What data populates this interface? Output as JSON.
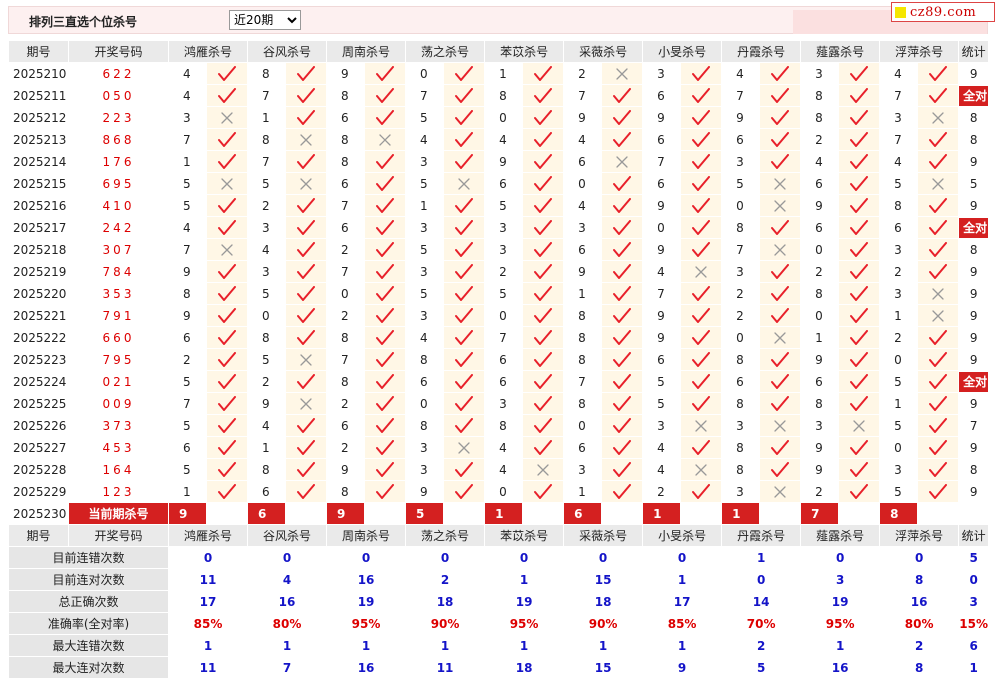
{
  "header": {
    "title": "排列三直选个位杀号",
    "range_select": "近20期",
    "logo_text": "cz89.com"
  },
  "columns": [
    "期号",
    "开奖号码",
    "鸿雁杀号",
    "谷风杀号",
    "周南杀号",
    "荡之杀号",
    "苯苡杀号",
    "采薇杀号",
    "小旻杀号",
    "丹霞杀号",
    "薤露杀号",
    "浮萍杀号",
    "统计"
  ],
  "all_correct_label": "全对",
  "rows": [
    {
      "period": "2025210",
      "draw": "622",
      "kills": [
        4,
        8,
        9,
        0,
        1,
        2,
        3,
        4,
        3,
        4
      ],
      "ok": [
        1,
        1,
        1,
        1,
        1,
        0,
        1,
        1,
        1,
        1
      ],
      "stat": "9"
    },
    {
      "period": "2025211",
      "draw": "050",
      "kills": [
        4,
        7,
        8,
        7,
        8,
        7,
        6,
        7,
        8,
        7
      ],
      "ok": [
        1,
        1,
        1,
        1,
        1,
        1,
        1,
        1,
        1,
        1
      ],
      "stat": "全对"
    },
    {
      "period": "2025212",
      "draw": "223",
      "kills": [
        3,
        1,
        6,
        5,
        0,
        9,
        9,
        9,
        8,
        3
      ],
      "ok": [
        0,
        1,
        1,
        1,
        1,
        1,
        1,
        1,
        1,
        0
      ],
      "stat": "8"
    },
    {
      "period": "2025213",
      "draw": "868",
      "kills": [
        7,
        8,
        8,
        4,
        4,
        4,
        6,
        6,
        2,
        7
      ],
      "ok": [
        1,
        0,
        0,
        1,
        1,
        1,
        1,
        1,
        1,
        1
      ],
      "stat": "8"
    },
    {
      "period": "2025214",
      "draw": "176",
      "kills": [
        1,
        7,
        8,
        3,
        9,
        6,
        7,
        3,
        4,
        4
      ],
      "ok": [
        1,
        1,
        1,
        1,
        1,
        0,
        1,
        1,
        1,
        1
      ],
      "stat": "9"
    },
    {
      "period": "2025215",
      "draw": "695",
      "kills": [
        5,
        5,
        6,
        5,
        6,
        0,
        6,
        5,
        6,
        5
      ],
      "ok": [
        0,
        0,
        1,
        0,
        1,
        1,
        1,
        0,
        1,
        0
      ],
      "stat": "5"
    },
    {
      "period": "2025216",
      "draw": "410",
      "kills": [
        5,
        2,
        7,
        1,
        5,
        4,
        9,
        0,
        9,
        8
      ],
      "ok": [
        1,
        1,
        1,
        1,
        1,
        1,
        1,
        0,
        1,
        1
      ],
      "stat": "9"
    },
    {
      "period": "2025217",
      "draw": "242",
      "kills": [
        4,
        3,
        6,
        3,
        3,
        3,
        0,
        8,
        6,
        6
      ],
      "ok": [
        1,
        1,
        1,
        1,
        1,
        1,
        1,
        1,
        1,
        1
      ],
      "stat": "全对"
    },
    {
      "period": "2025218",
      "draw": "307",
      "kills": [
        7,
        4,
        2,
        5,
        3,
        6,
        9,
        7,
        0,
        3
      ],
      "ok": [
        0,
        1,
        1,
        1,
        1,
        1,
        1,
        0,
        1,
        1
      ],
      "stat": "8"
    },
    {
      "period": "2025219",
      "draw": "784",
      "kills": [
        9,
        3,
        7,
        3,
        2,
        9,
        4,
        3,
        2,
        2
      ],
      "ok": [
        1,
        1,
        1,
        1,
        1,
        1,
        0,
        1,
        1,
        1
      ],
      "stat": "9"
    },
    {
      "period": "2025220",
      "draw": "353",
      "kills": [
        8,
        5,
        0,
        5,
        5,
        1,
        7,
        2,
        8,
        3
      ],
      "ok": [
        1,
        1,
        1,
        1,
        1,
        1,
        1,
        1,
        1,
        0
      ],
      "stat": "9"
    },
    {
      "period": "2025221",
      "draw": "791",
      "kills": [
        9,
        0,
        2,
        3,
        0,
        8,
        9,
        2,
        0,
        1
      ],
      "ok": [
        1,
        1,
        1,
        1,
        1,
        1,
        1,
        1,
        1,
        0
      ],
      "stat": "9"
    },
    {
      "period": "2025222",
      "draw": "660",
      "kills": [
        6,
        8,
        8,
        4,
        7,
        8,
        9,
        0,
        1,
        2
      ],
      "ok": [
        1,
        1,
        1,
        1,
        1,
        1,
        1,
        0,
        1,
        1
      ],
      "stat": "9"
    },
    {
      "period": "2025223",
      "draw": "795",
      "kills": [
        2,
        5,
        7,
        8,
        6,
        8,
        6,
        8,
        9,
        0
      ],
      "ok": [
        1,
        0,
        1,
        1,
        1,
        1,
        1,
        1,
        1,
        1
      ],
      "stat": "9"
    },
    {
      "period": "2025224",
      "draw": "021",
      "kills": [
        5,
        2,
        8,
        6,
        6,
        7,
        5,
        6,
        6,
        5
      ],
      "ok": [
        1,
        1,
        1,
        1,
        1,
        1,
        1,
        1,
        1,
        1
      ],
      "stat": "全对"
    },
    {
      "period": "2025225",
      "draw": "009",
      "kills": [
        7,
        9,
        2,
        0,
        3,
        8,
        5,
        8,
        8,
        1
      ],
      "ok": [
        1,
        0,
        1,
        1,
        1,
        1,
        1,
        1,
        1,
        1
      ],
      "stat": "9"
    },
    {
      "period": "2025226",
      "draw": "373",
      "kills": [
        5,
        4,
        6,
        8,
        8,
        0,
        3,
        3,
        3,
        5
      ],
      "ok": [
        1,
        1,
        1,
        1,
        1,
        1,
        0,
        0,
        0,
        1
      ],
      "stat": "7"
    },
    {
      "period": "2025227",
      "draw": "453",
      "kills": [
        6,
        1,
        2,
        3,
        4,
        6,
        4,
        8,
        9,
        0
      ],
      "ok": [
        1,
        1,
        1,
        0,
        1,
        1,
        1,
        1,
        1,
        1
      ],
      "stat": "9"
    },
    {
      "period": "2025228",
      "draw": "164",
      "kills": [
        5,
        8,
        9,
        3,
        4,
        3,
        4,
        8,
        9,
        3
      ],
      "ok": [
        1,
        1,
        1,
        1,
        0,
        1,
        0,
        1,
        1,
        1
      ],
      "stat": "8"
    },
    {
      "period": "2025229",
      "draw": "123",
      "kills": [
        1,
        6,
        8,
        9,
        0,
        1,
        2,
        3,
        2,
        5
      ],
      "ok": [
        1,
        1,
        1,
        1,
        1,
        1,
        1,
        0,
        1,
        1
      ],
      "stat": "9"
    }
  ],
  "current": {
    "period": "2025230",
    "label": "当前期杀号",
    "kills": [
      "9",
      "6",
      "9",
      "5",
      "1",
      "6",
      "1",
      "1",
      "7",
      "8"
    ]
  },
  "stats": [
    {
      "label": "目前连错次数",
      "values": [
        "0",
        "0",
        "0",
        "0",
        "0",
        "0",
        "0",
        "1",
        "0",
        "0",
        "5"
      ]
    },
    {
      "label": "目前连对次数",
      "values": [
        "11",
        "4",
        "16",
        "2",
        "1",
        "15",
        "1",
        "0",
        "3",
        "8",
        "0"
      ]
    },
    {
      "label": "总正确次数",
      "values": [
        "17",
        "16",
        "19",
        "18",
        "19",
        "18",
        "17",
        "14",
        "19",
        "16",
        "3"
      ]
    },
    {
      "label": "准确率(全对率)",
      "values": [
        "85%",
        "80%",
        "95%",
        "90%",
        "95%",
        "90%",
        "85%",
        "70%",
        "95%",
        "80%",
        "15%"
      ]
    },
    {
      "label": "最大连错次数",
      "values": [
        "1",
        "1",
        "1",
        "1",
        "1",
        "1",
        "1",
        "2",
        "1",
        "2",
        "6"
      ]
    },
    {
      "label": "最大连对次数",
      "values": [
        "11",
        "7",
        "16",
        "11",
        "18",
        "15",
        "9",
        "5",
        "16",
        "8",
        "1"
      ]
    }
  ],
  "colors": {
    "check": "#e8202a",
    "cross": "#999999",
    "accent": "#d42020",
    "stat_value": "#1414c8"
  }
}
